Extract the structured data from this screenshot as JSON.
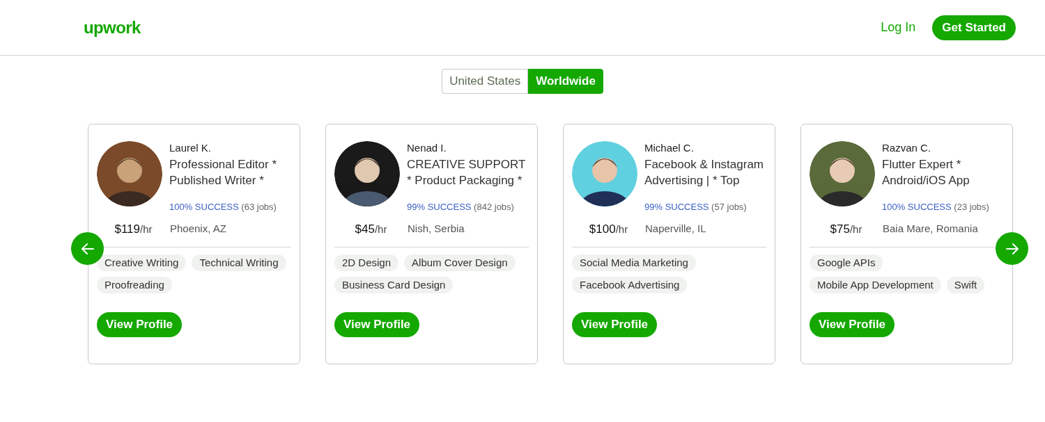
{
  "header": {
    "logo": "upwork",
    "login": "Log In",
    "cta": "Get Started"
  },
  "region_toggle": [
    {
      "label": "United States",
      "selected": false
    },
    {
      "label": "Worldwide",
      "selected": true
    }
  ],
  "freelancers": [
    {
      "name": "Laurel K.",
      "title": "Professional Editor * Published Writer *",
      "success": "100% SUCCESS",
      "jobs": "(63 jobs)",
      "rate": "$119",
      "unit": "/hr",
      "location": "Phoenix, AZ",
      "skills": [
        "Creative Writing",
        "Technical Writing",
        "Proofreading"
      ],
      "button": "View Profile"
    },
    {
      "name": "Nenad I.",
      "title": "CREATIVE SUPPORT * Product Packaging *",
      "success": "99% SUCCESS",
      "jobs": "(842 jobs)",
      "rate": "$45",
      "unit": "/hr",
      "location": "Nish, Serbia",
      "skills": [
        "2D Design",
        "Album Cover Design",
        "Business Card Design"
      ],
      "button": "View Profile"
    },
    {
      "name": "Michael C.",
      "title": "Facebook & Instagram Advertising | * Top",
      "success": "99% SUCCESS",
      "jobs": "(57 jobs)",
      "rate": "$100",
      "unit": "/hr",
      "location": "Naperville, IL",
      "skills": [
        "Social Media Marketing",
        "Facebook Advertising"
      ],
      "button": "View Profile"
    },
    {
      "name": "Razvan C.",
      "title": "Flutter Expert * Android/iOS App",
      "success": "100% SUCCESS",
      "jobs": "(23 jobs)",
      "rate": "$75",
      "unit": "/hr",
      "location": "Baia Mare, Romania",
      "skills": [
        "Google APIs",
        "Mobile App Development",
        "Swift"
      ],
      "button": "View Profile"
    }
  ]
}
